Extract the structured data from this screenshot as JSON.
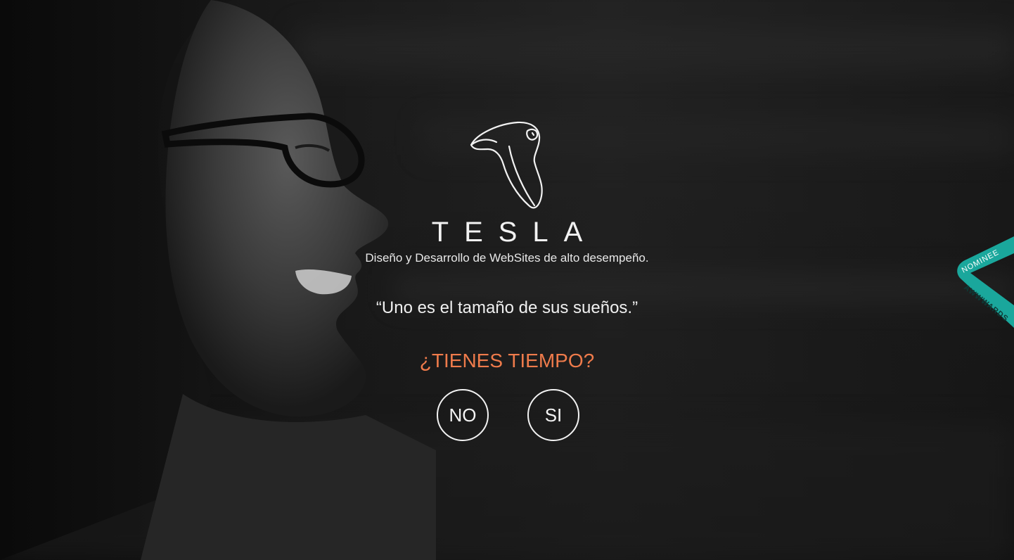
{
  "brand": {
    "name": "TESLA",
    "tagline": "Diseño y Desarrollo de WebSites de alto desempeño."
  },
  "quote": "“Uno es el tamaño de sus sueños.”",
  "prompt": {
    "question": "¿TIENES TIEMPO?",
    "no_label": "NO",
    "yes_label": "SI"
  },
  "award_ribbon": {
    "line1": "NOMINEE",
    "line2": "AWWWARDS",
    "color": "#1aa79c"
  },
  "colors": {
    "accent": "#ef7b4b",
    "text": "#f2f2f2"
  }
}
